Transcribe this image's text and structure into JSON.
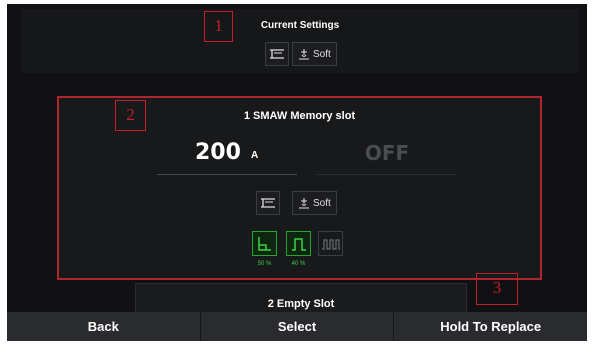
{
  "current_settings": {
    "title": "Current Settings",
    "arc_label": "Soft"
  },
  "memory_slot": {
    "title": "1 SMAW Memory slot",
    "current_value": "200",
    "current_unit": "A",
    "secondary_value": "OFF",
    "arc_label": "Soft",
    "modes": [
      {
        "icon": "hot-start-icon",
        "percent": "50 %",
        "active": true
      },
      {
        "icon": "arc-force-icon",
        "percent": "40 %",
        "active": true
      },
      {
        "icon": "pulse-icon",
        "active": false
      }
    ]
  },
  "next_slot": {
    "title": "2 Empty Slot"
  },
  "bottom_bar": {
    "back": "Back",
    "select": "Select",
    "hold_to_replace": "Hold To Replace"
  },
  "callouts": [
    "1",
    "2",
    "3"
  ],
  "colors": {
    "background": "#111113",
    "selected_border": "#b0262f",
    "active_green": "#26a52e",
    "callout_red": "#c0202b"
  }
}
